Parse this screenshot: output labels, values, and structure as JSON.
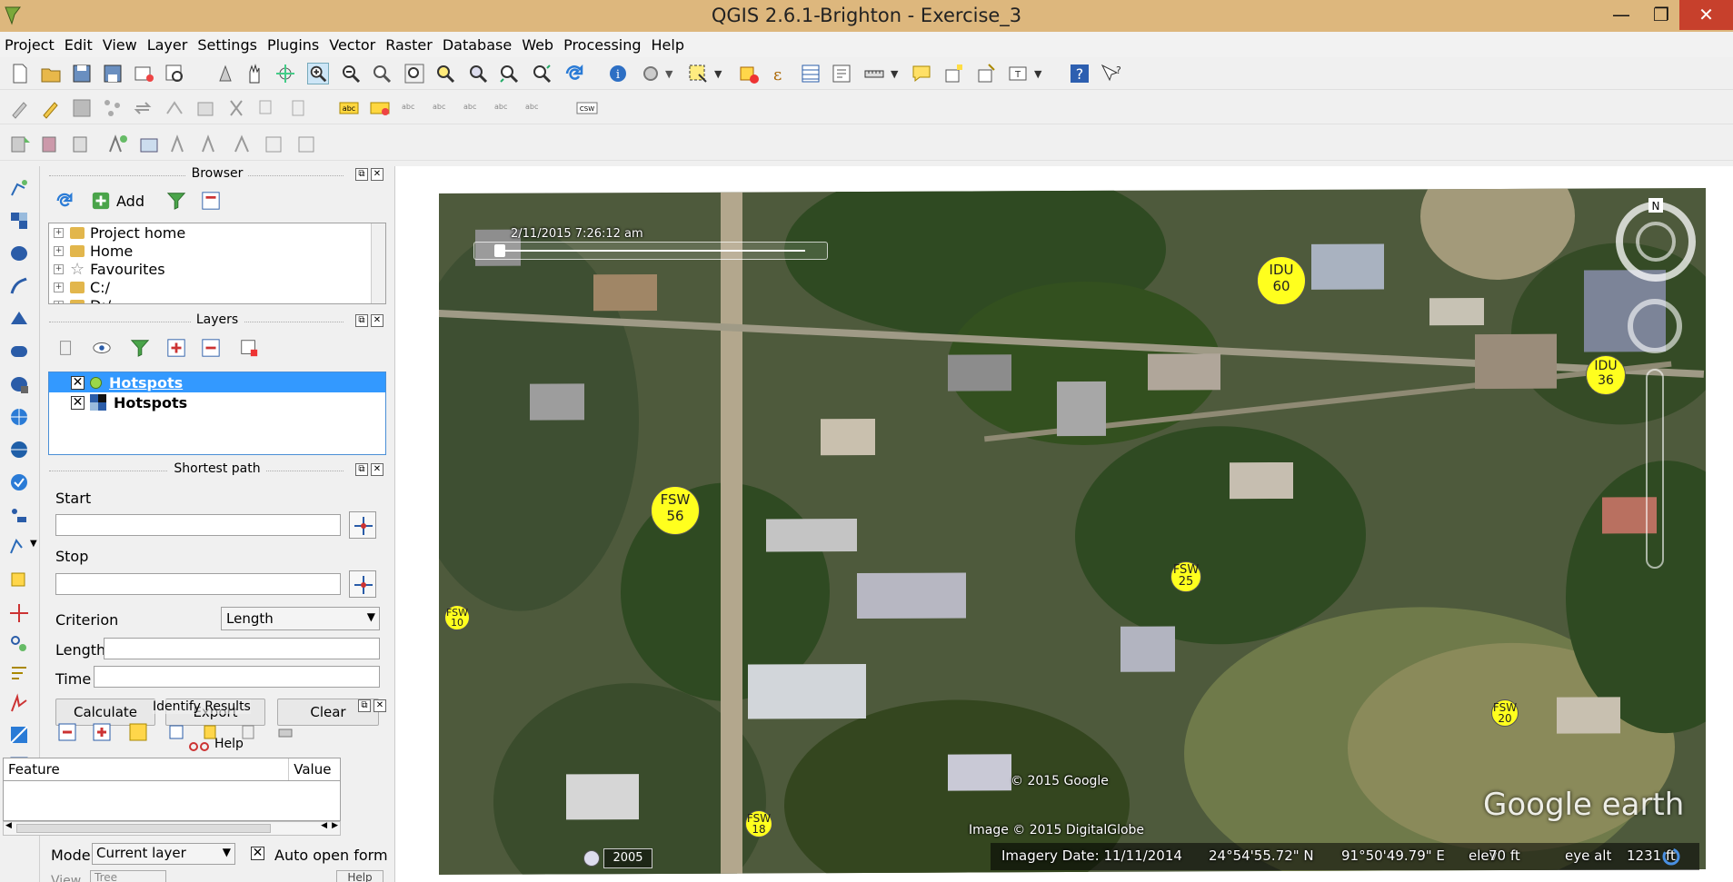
{
  "window": {
    "title": "QGIS 2.6.1-Brighton - Exercise_3",
    "minimize": "—",
    "maximize": "❐",
    "close": "✕"
  },
  "menu": [
    "Project",
    "Edit",
    "View",
    "Layer",
    "Settings",
    "Plugins",
    "Vector",
    "Raster",
    "Database",
    "Web",
    "Processing",
    "Help"
  ],
  "browser": {
    "title": "Browser",
    "add_label": "Add",
    "items": [
      "Project home",
      "Home",
      "Favourites",
      "C:/",
      "D:/"
    ]
  },
  "layers": {
    "title": "Layers",
    "items": [
      {
        "name": "Hotspots",
        "checked": "✕",
        "selected": true
      },
      {
        "name": "Hotspots",
        "checked": "✕",
        "selected": false
      }
    ]
  },
  "shortest_path": {
    "title": "Shortest path",
    "start_label": "Start",
    "stop_label": "Stop",
    "criterion_label": "Criterion",
    "criterion_value": "Length",
    "length_label": "Length",
    "time_label": "Time",
    "calculate_label": "Calculate",
    "export_label": "Export",
    "clear_label": "Clear",
    "help_label": "Help"
  },
  "identify": {
    "title": "Identify Results",
    "col_feature": "Feature",
    "col_value": "Value",
    "mode_label": "Mode",
    "mode_value": "Current layer",
    "auto_open_label": "Auto open form",
    "auto_open_checked": "✕",
    "view_label": "View",
    "view_value": "Tree",
    "help_label": "Help"
  },
  "map": {
    "timestamp": "2/11/2015   7:26:12 am",
    "copyright_google": "© 2015 Google",
    "copyright_image": "Image © 2015 DigitalGlobe",
    "logo": "Google earth",
    "year_label": "2005",
    "status": {
      "imagery_date": "Imagery Date: 11/11/2014",
      "lat": "24°54'55.72\" N",
      "lon": "91°50'49.79\" E",
      "elev_label": "elev",
      "elev": "70 ft",
      "eye_label": "eye alt",
      "eye_alt": "1231 ft"
    },
    "hotspots": [
      {
        "type": "IDU",
        "count": "60"
      },
      {
        "type": "IDU",
        "count": "36"
      },
      {
        "type": "FSW",
        "count": "56"
      },
      {
        "type": "FSW",
        "count": "25"
      },
      {
        "type": "FSW",
        "count": "10"
      },
      {
        "type": "FSW",
        "count": "20"
      },
      {
        "type": "FSW",
        "count": "18"
      }
    ]
  },
  "colors": {
    "titlebar": "#ddb77d",
    "close": "#c7402c",
    "hotspot": "#ffff1e",
    "selection": "#3399ff"
  }
}
